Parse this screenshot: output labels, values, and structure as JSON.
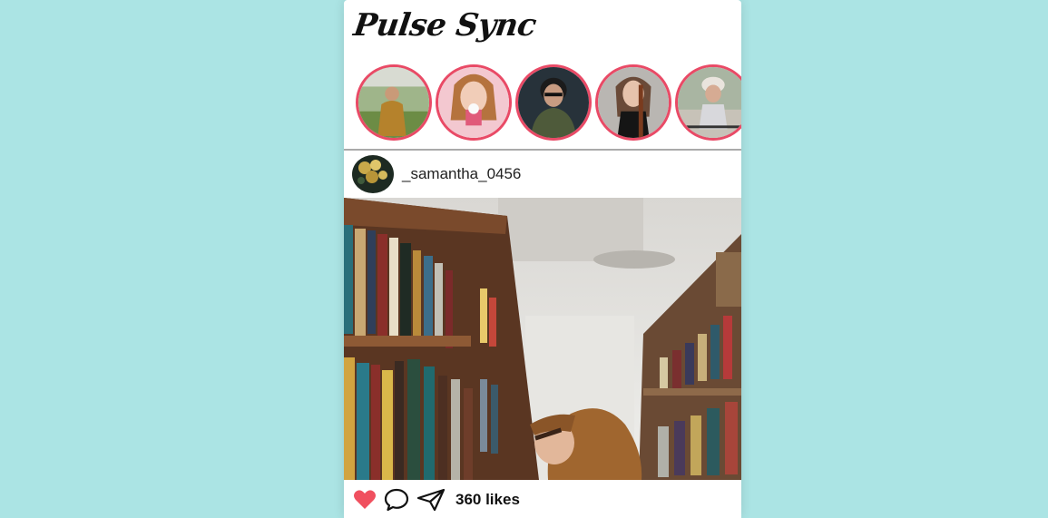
{
  "app": {
    "title": "Pulse Sync",
    "background_color": "#abe4e4",
    "accent_color": "#e94a66"
  },
  "stories": [
    {
      "name": "story-1",
      "scene": "girl in yellow coat in field"
    },
    {
      "name": "story-2",
      "scene": "girl with cupcake"
    },
    {
      "name": "story-3",
      "scene": "person with glasses in green jacket"
    },
    {
      "name": "story-4",
      "scene": "woman with violin"
    },
    {
      "name": "story-5",
      "scene": "cyclist with helmet"
    }
  ],
  "post": {
    "username": "_samantha_0456",
    "avatar_icon": "flowers-avatar",
    "photo": "woman in library aisle",
    "likes_text": "360 likes",
    "liked": true
  },
  "actions": {
    "like_icon": "heart-icon",
    "comment_icon": "comment-icon",
    "share_icon": "send-icon"
  }
}
